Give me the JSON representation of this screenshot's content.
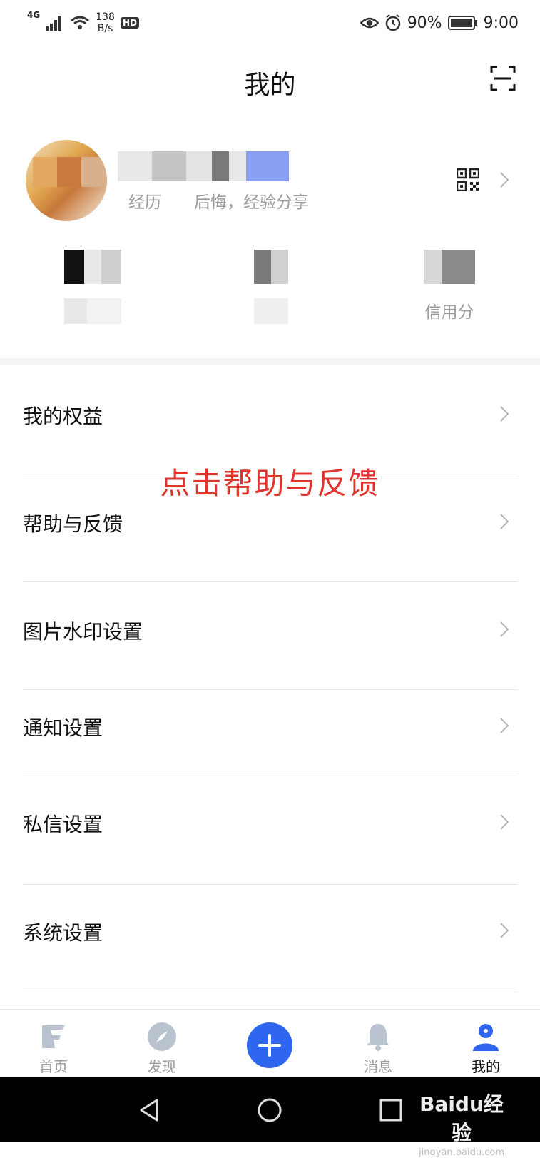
{
  "status_bar": {
    "network": "4G",
    "speed_value": "138",
    "speed_unit": "B/s",
    "hd_badge": "HD",
    "battery": "90%",
    "time": "9:00"
  },
  "header": {
    "title": "我的",
    "scan_icon": "scan-icon"
  },
  "profile": {
    "bio": "经历　　后悔，经验分享",
    "qr_icon": "qr-code-icon"
  },
  "stats": {
    "items": [
      {
        "label": ""
      },
      {
        "label": ""
      },
      {
        "label": "信用分"
      }
    ]
  },
  "menu": {
    "items": [
      {
        "label": "我的权益"
      },
      {
        "label": "帮助与反馈"
      },
      {
        "label": "图片水印设置"
      },
      {
        "label": "通知设置"
      },
      {
        "label": "私信设置"
      },
      {
        "label": "系统设置"
      }
    ]
  },
  "annotation": {
    "text": "点击帮助与反馈"
  },
  "bottom_nav": {
    "items": [
      {
        "label": "首页",
        "icon": "home-icon"
      },
      {
        "label": "发现",
        "icon": "compass-icon"
      },
      {
        "label": "",
        "icon": "plus-icon"
      },
      {
        "label": "消息",
        "icon": "bell-icon"
      },
      {
        "label": "我的",
        "icon": "user-icon"
      }
    ],
    "active_index": 4
  },
  "watermark": {
    "brand": "Baidu经验",
    "url": "jingyan.baidu.com"
  },
  "colors": {
    "accent": "#2f66f0",
    "annotation": "#e0342c",
    "muted": "#9a9a9a"
  }
}
